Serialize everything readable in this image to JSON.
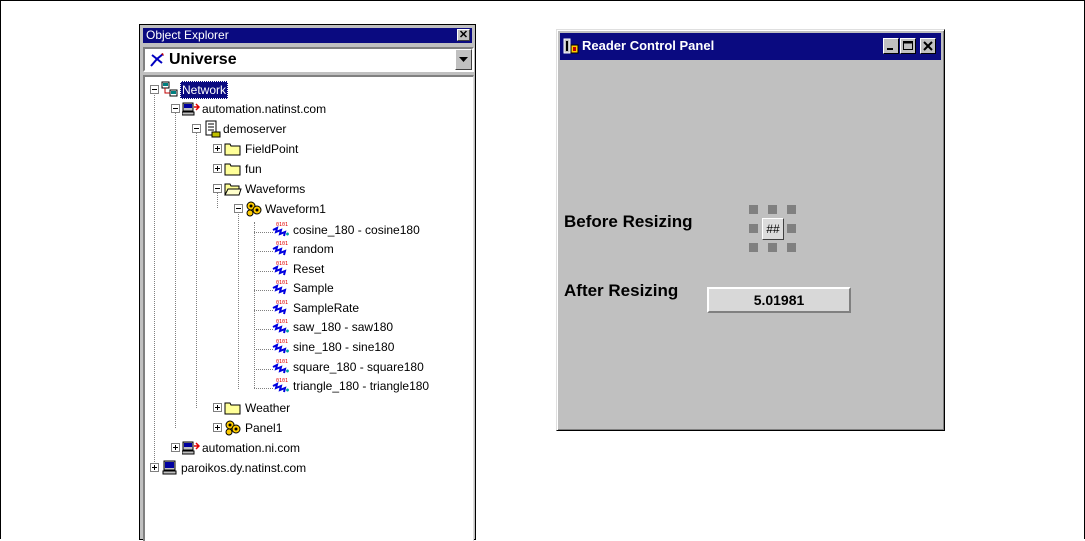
{
  "object_explorer": {
    "title": "Object Explorer",
    "close_glyph": "✕",
    "selector": {
      "value": "Universe",
      "icon": "universe-icon"
    },
    "tree": [
      {
        "label": "Network",
        "icon": "network-icon",
        "selected": true
      },
      {
        "label": "automation.natinst.com",
        "icon": "server-host-icon"
      },
      {
        "label": "demoserver",
        "icon": "document-server-icon"
      },
      {
        "label": "FieldPoint",
        "icon": "folder-icon"
      },
      {
        "label": "fun",
        "icon": "folder-icon"
      },
      {
        "label": "Waveforms",
        "icon": "folder-open-icon"
      },
      {
        "label": "Waveform1",
        "icon": "panel-icon"
      },
      {
        "label": "cosine_180 - cosine180",
        "icon": "io-item-icon"
      },
      {
        "label": "random",
        "icon": "io-item-icon"
      },
      {
        "label": "Reset",
        "icon": "io-item-icon"
      },
      {
        "label": "Sample",
        "icon": "io-item-icon"
      },
      {
        "label": "SampleRate",
        "icon": "io-item-icon"
      },
      {
        "label": "saw_180 - saw180",
        "icon": "io-item-icon"
      },
      {
        "label": "sine_180 - sine180",
        "icon": "io-item-icon"
      },
      {
        "label": "square_180 - square180",
        "icon": "io-item-icon"
      },
      {
        "label": "triangle_180 - triangle180",
        "icon": "io-item-icon"
      },
      {
        "label": "Weather",
        "icon": "folder-icon"
      },
      {
        "label": "Panel1",
        "icon": "panel-icon"
      },
      {
        "label": "automation.ni.com",
        "icon": "server-host-icon"
      },
      {
        "label": "paroikos.dy.natinst.com",
        "icon": "computer-icon"
      }
    ]
  },
  "reader_panel": {
    "title": "Reader Control Panel",
    "before_label": "Before Resizing",
    "placeholder_text": "##",
    "after_label": "After Resizing",
    "value": "5.01981"
  },
  "colors": {
    "titlebar": "#0a0a80",
    "window_bg": "#c0c0c0",
    "selection": "#0a0a80"
  }
}
